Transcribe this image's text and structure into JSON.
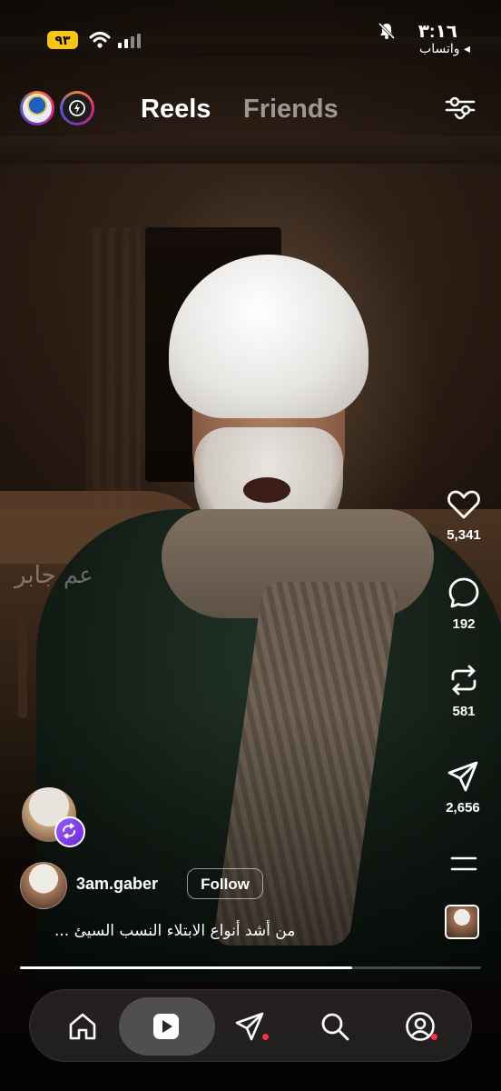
{
  "status_bar": {
    "battery": "٩٣",
    "time": "٣:١٦",
    "back_app": "◂ واتساب"
  },
  "header": {
    "tabs": [
      {
        "label": "Reels",
        "active": true
      },
      {
        "label": "Friends",
        "active": false
      }
    ]
  },
  "video": {
    "watermark": "عم جابر"
  },
  "actions": {
    "likes": "5,341",
    "comments": "192",
    "reposts": "581",
    "shares": "2,656"
  },
  "post": {
    "username": "3am.gaber",
    "follow_label": "Follow",
    "caption": "من أشد أنواع الابتلاء النسب السيئ ...",
    "progress": 0.72
  },
  "nav": {
    "items": [
      {
        "icon": "home-icon"
      },
      {
        "icon": "reels-icon",
        "active": true
      },
      {
        "icon": "messages-icon",
        "badge": true
      },
      {
        "icon": "search-icon"
      },
      {
        "icon": "profile-icon",
        "badge": true
      }
    ]
  },
  "colors": {
    "accent_badge": "#ff3040",
    "battery": "#f5c518",
    "remix": "#7c3aed"
  }
}
